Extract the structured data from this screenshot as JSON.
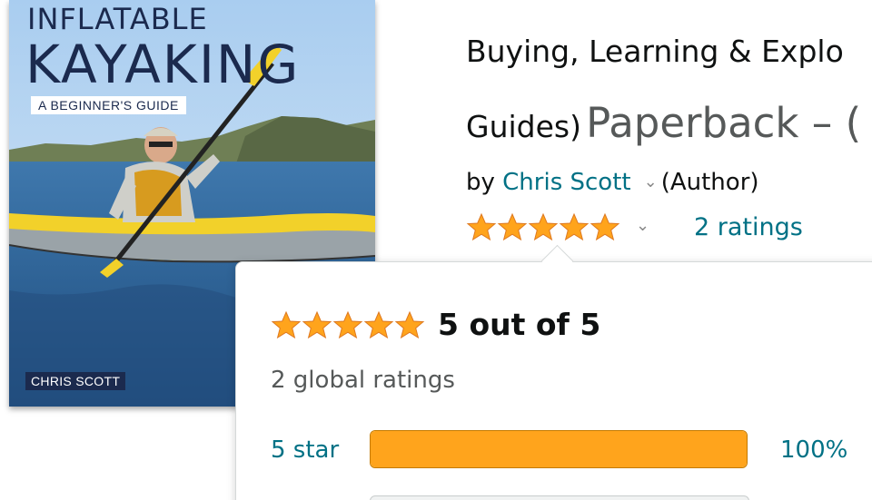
{
  "cover": {
    "title_line_1": "INFLATABLE",
    "title_line_2": "KAYAKING",
    "subtitle": "A BEGINNER'S GUIDE",
    "author": "CHRIS SCOTT"
  },
  "product": {
    "title_line_1": "Buying, Learning & Explo",
    "series": "Guides)",
    "format": "Paperback – ("
  },
  "byline": {
    "prefix": "by",
    "author": "Chris Scott",
    "role": "(Author)"
  },
  "rating": {
    "stars": 5,
    "max_stars": 5,
    "ratings_link": "2 ratings",
    "star_color": "#ffa41c"
  },
  "popover": {
    "rating_text": "5 out of 5",
    "global_ratings": "2 global ratings",
    "histogram": [
      {
        "label": "5 star",
        "percent": 100,
        "percent_label": "100%"
      }
    ]
  },
  "colors": {
    "link": "#007185",
    "bar_fill": "#ffa41c",
    "cover_title": "#1b2a4e"
  },
  "icons": {
    "star": "star-icon",
    "chevron": "chevron-down-icon"
  }
}
